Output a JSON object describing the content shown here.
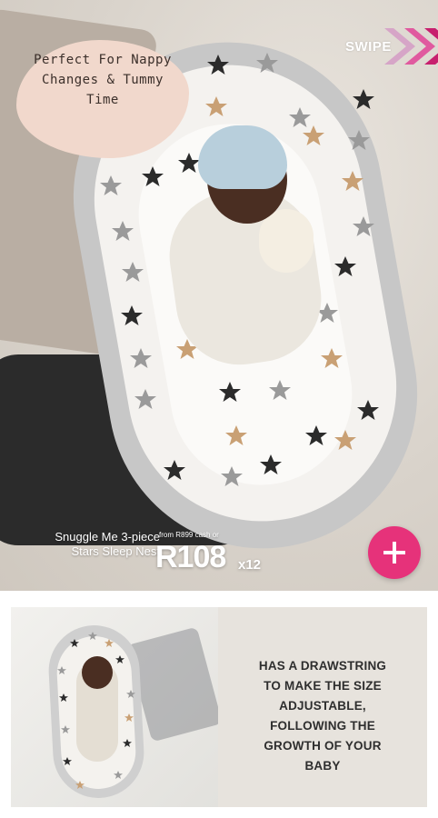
{
  "hero": {
    "callout_text": "Perfect for nappy changes & tummy time",
    "swipe_label": "SWIPE",
    "product_name_line1": "Snuggle Me 3-piece",
    "product_name_line2": "Stars Sleep Nest",
    "price_note": "from R899 cash or",
    "price": "R108",
    "price_multiplier": "x12",
    "add_button_icon": "plus-icon"
  },
  "details": {
    "lines": [
      "HAS A DRAWSTRING",
      "TO MAKE THE SIZE",
      "ADJUSTABLE,",
      "FOLLOWING THE",
      "GROWTH OF YOUR",
      "BABY"
    ]
  },
  "colors": {
    "accent_pink": "#e6327a",
    "callout_bg": "#f1d8cc",
    "panel_bg": "#e7e3dd"
  }
}
